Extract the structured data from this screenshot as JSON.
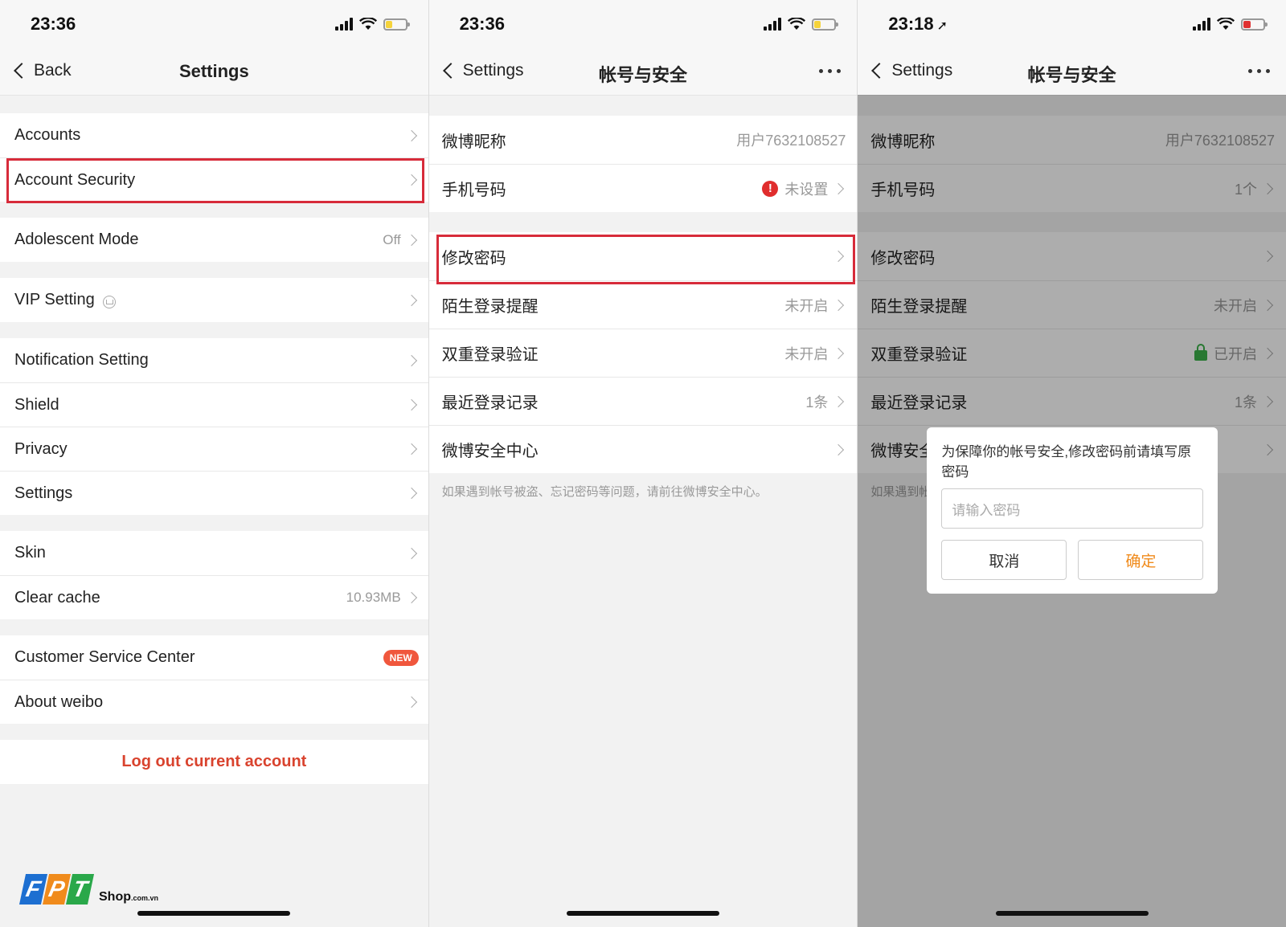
{
  "screen1": {
    "status": {
      "time": "23:36"
    },
    "nav": {
      "back": "Back",
      "title": "Settings"
    },
    "groups": [
      [
        {
          "label": "Accounts",
          "value": ""
        },
        {
          "label": "Account Security",
          "value": ""
        }
      ],
      [
        {
          "label": "Adolescent Mode",
          "value": "Off"
        }
      ],
      [
        {
          "label": "VIP Setting",
          "value": ""
        }
      ],
      [
        {
          "label": "Notification Setting",
          "value": ""
        },
        {
          "label": "Shield",
          "value": ""
        },
        {
          "label": "Privacy",
          "value": ""
        },
        {
          "label": "Settings",
          "value": ""
        }
      ],
      [
        {
          "label": "Skin",
          "value": ""
        },
        {
          "label": "Clear cache",
          "value": "10.93MB"
        }
      ],
      [
        {
          "label": "Customer Service Center",
          "badge": "NEW"
        },
        {
          "label": "About weibo",
          "value": ""
        }
      ]
    ],
    "logout": "Log out current account",
    "logo": {
      "letters": [
        "F",
        "P",
        "T"
      ],
      "shop": "Shop",
      "domain": ".com.vn",
      "colors": [
        "#1d6fd1",
        "#f08b1c",
        "#2aa84a"
      ]
    }
  },
  "screen2": {
    "status": {
      "time": "23:36"
    },
    "nav": {
      "back": "Settings",
      "title": "帐号与安全"
    },
    "groups": [
      [
        {
          "label": "微博昵称",
          "value": "用户7632108527"
        },
        {
          "label": "手机号码",
          "value": "未设置"
        }
      ],
      [
        {
          "label": "修改密码",
          "value": ""
        },
        {
          "label": "陌生登录提醒",
          "value": "未开启"
        },
        {
          "label": "双重登录验证",
          "value": "未开启"
        },
        {
          "label": "最近登录记录",
          "value": "1条"
        },
        {
          "label": "微博安全中心",
          "value": ""
        }
      ]
    ],
    "footnote": "如果遇到帐号被盗、忘记密码等问题，请前往微博安全中心。"
  },
  "screen3": {
    "status": {
      "time": "23:18"
    },
    "nav": {
      "back": "Settings",
      "title": "帐号与安全"
    },
    "groups": [
      [
        {
          "label": "微博昵称",
          "value": "用户7632108527"
        },
        {
          "label": "手机号码",
          "value": "1个"
        }
      ],
      [
        {
          "label": "修改密码",
          "value": ""
        },
        {
          "label": "陌生登录提醒",
          "value": "未开启"
        },
        {
          "label": "双重登录验证",
          "value": "已开启"
        },
        {
          "label": "最近登录记录",
          "value": "1条"
        },
        {
          "label": "微博安全",
          "value": ""
        }
      ]
    ],
    "footnote": "如果遇到帐",
    "dialog": {
      "message": "为保障你的帐号安全,修改密码前请填写原密码",
      "placeholder": "请输入密码",
      "cancel": "取消",
      "confirm": "确定"
    }
  },
  "colors": {
    "accent_red": "#d72b3a",
    "logout_red": "#d9432e",
    "confirm_orange": "#f08b1c",
    "lock_green": "#3cb14a"
  }
}
